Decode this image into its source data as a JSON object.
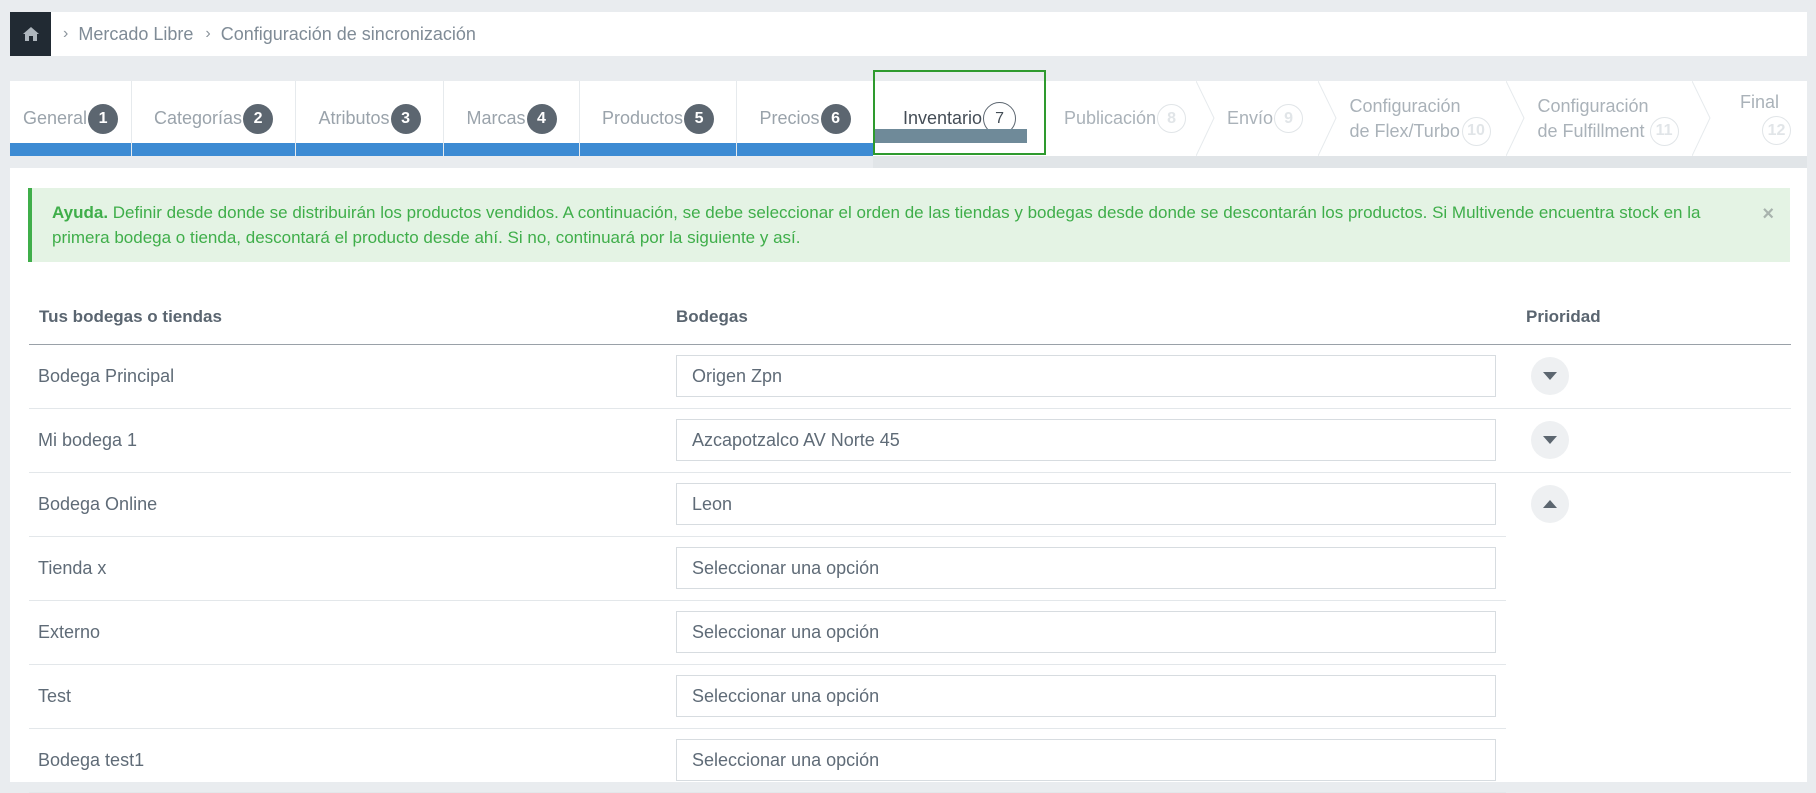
{
  "breadcrumb": {
    "items": [
      "Mercado Libre",
      "Configuración de sincronización"
    ]
  },
  "steps": [
    {
      "label": "General",
      "num": "1",
      "state": "done"
    },
    {
      "label": "Categorías",
      "num": "2",
      "state": "done"
    },
    {
      "label": "Atributos",
      "num": "3",
      "state": "done"
    },
    {
      "label": "Marcas",
      "num": "4",
      "state": "done"
    },
    {
      "label": "Productos",
      "num": "5",
      "state": "done"
    },
    {
      "label": "Precios",
      "num": "6",
      "state": "done"
    },
    {
      "label": "Inventario",
      "num": "7",
      "state": "active"
    },
    {
      "label": "Publicación",
      "num": "8",
      "state": "upcoming"
    },
    {
      "label": "Envío",
      "num": "9",
      "state": "upcoming"
    },
    {
      "label_line1": "Configuración",
      "label_line2": "de Flex/Turbo",
      "num": "10",
      "state": "upcoming"
    },
    {
      "label_line1": "Configuración",
      "label_line2": "de Fulfillment",
      "num": "11",
      "state": "upcoming"
    },
    {
      "label": "Final",
      "num": "12",
      "state": "upcoming"
    }
  ],
  "alert": {
    "title": "Ayuda.",
    "text": " Definir desde donde se distribuirán los productos vendidos. A continuación, se debe seleccionar el orden de las tiendas y bodegas desde donde se descontarán los productos. Si Multivende encuentra stock en la primera bodega o tienda, descontará el producto desde ahí. Si no, continuará por la siguiente y así.",
    "close": "×"
  },
  "table": {
    "headers": {
      "stores": "Tus bodegas o tiendas",
      "warehouses": "Bodegas",
      "priority": "Prioridad"
    },
    "rows": [
      {
        "name": "Bodega Principal",
        "warehouse": "Origen Zpn",
        "priority": "down"
      },
      {
        "name": "Mi bodega 1",
        "warehouse": "Azcapotzalco AV Norte 45",
        "priority": "down"
      },
      {
        "name": "Bodega Online",
        "warehouse": "Leon",
        "priority": "up"
      },
      {
        "name": "Tienda x",
        "warehouse": "Seleccionar una opción"
      },
      {
        "name": "Externo",
        "warehouse": "Seleccionar una opción"
      },
      {
        "name": "Test",
        "warehouse": "Seleccionar una opción"
      },
      {
        "name": "Bodega test1",
        "warehouse": "Seleccionar una opción"
      }
    ]
  },
  "colors": {
    "accent": "#3d8bd3",
    "success": "#3fae4a",
    "dark": "#212a33"
  }
}
